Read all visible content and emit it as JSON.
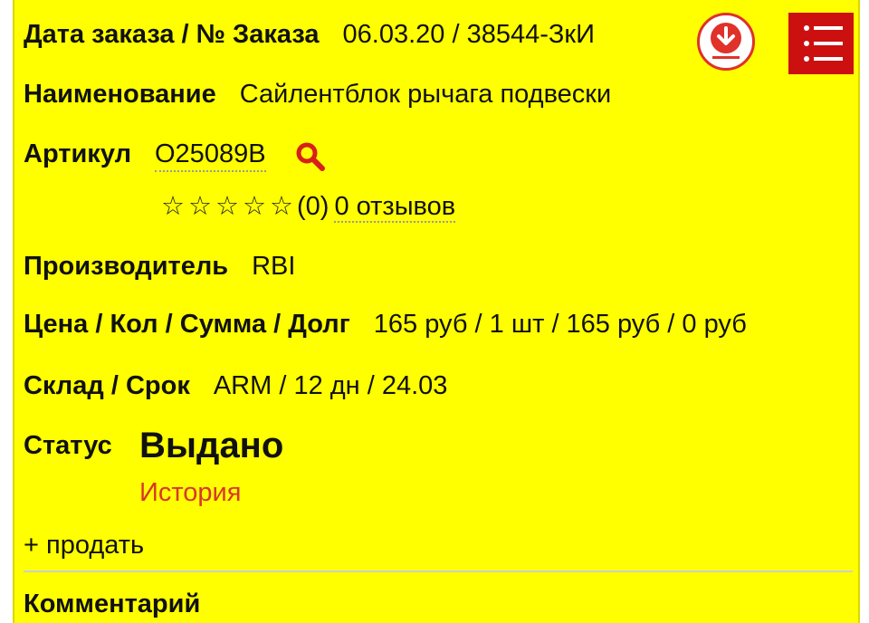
{
  "order": {
    "label": "Дата заказа / № Заказа",
    "value": "06.03.20 / 38544-ЗкИ"
  },
  "name": {
    "label": "Наименование",
    "value": "Сайлентблок рычага подвески"
  },
  "article": {
    "label": "Артикул",
    "value": "O25089B"
  },
  "rating": {
    "stars": 0,
    "max_stars": 5,
    "star_glyph": "☆",
    "count_text": "(0)",
    "reviews_text": "0 отзывов"
  },
  "maker": {
    "label": "Производитель",
    "value": "RBI"
  },
  "price": {
    "label": "Цена / Кол / Сумма / Долг",
    "value": "165 руб / 1 шт / 165 руб / 0 руб"
  },
  "warehouse": {
    "label": "Склад / Срок",
    "value": "ARM / 12 дн / 24.03"
  },
  "status": {
    "label": "Статус",
    "value": "Выдано",
    "history_link": "История"
  },
  "sell_link": "+ продать",
  "comment_label": "Комментарий",
  "icons": {
    "download": "download-icon",
    "menu": "menu-list-icon",
    "search": "search-icon"
  },
  "colors": {
    "background": "#ffff00",
    "accent_red": "#cc1010",
    "link_red": "#d7372b"
  }
}
